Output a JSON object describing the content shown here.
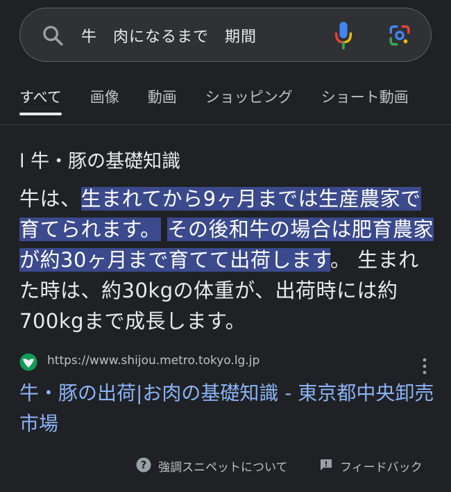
{
  "search": {
    "query": "牛　肉になるまで　期間"
  },
  "tabs": [
    {
      "label": "すべて",
      "active": true
    },
    {
      "label": "画像"
    },
    {
      "label": "動画"
    },
    {
      "label": "ショッピング"
    },
    {
      "label": "ショート動画"
    }
  ],
  "snippet": {
    "heading": "l 牛・豚の基礎知識",
    "text_before": "牛は、",
    "text_highlight_1": "生まれてから9ヶ月までは生産農家で育てられます。",
    "text_highlight_2": "その後和牛の場合は肥育農家が約30ヶ月まで育てて出荷します",
    "text_after": "。 生まれた時は、約30kgの体重が、出荷時には約700kgまで成長します。"
  },
  "source": {
    "url": "https://www.shijou.metro.tokyo.lg.jp",
    "title": "牛・豚の出荷|お肉の基礎知識 - 東京都中央卸売市場"
  },
  "footer": {
    "help_label": "強調スニペットについて",
    "feedback_label": "フィードバック"
  },
  "colors": {
    "background": "#202124",
    "search_bg": "#303134",
    "highlight": "#3b4a8d",
    "link": "#8ab4f8",
    "favicon": "#0f9d58"
  },
  "icons": [
    "search-icon",
    "mic-icon",
    "lens-icon",
    "favicon-icon",
    "more-vert-icon",
    "help-icon",
    "feedback-icon"
  ]
}
